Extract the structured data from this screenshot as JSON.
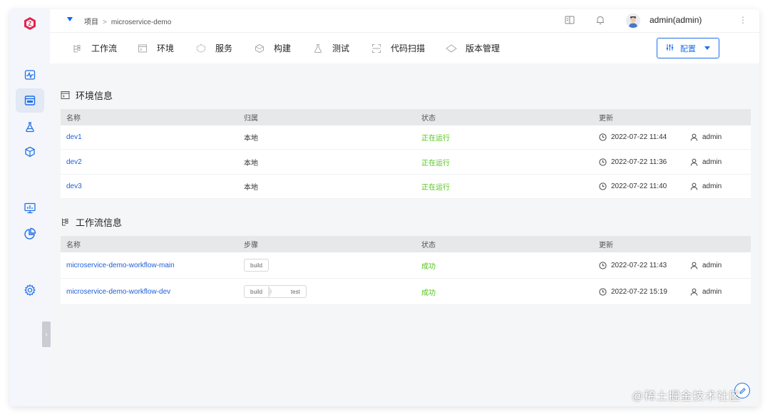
{
  "breadcrumb": {
    "root": "项目",
    "separator": ">",
    "project": "microservice-demo"
  },
  "user": {
    "name": "admin(admin)"
  },
  "tabs": [
    {
      "label": "工作流",
      "icon": "workflow-icon"
    },
    {
      "label": "环境",
      "icon": "environment-icon"
    },
    {
      "label": "服务",
      "icon": "service-icon"
    },
    {
      "label": "构建",
      "icon": "build-icon"
    },
    {
      "label": "测试",
      "icon": "test-icon"
    },
    {
      "label": "代码扫描",
      "icon": "scan-icon"
    },
    {
      "label": "版本管理",
      "icon": "version-icon"
    }
  ],
  "config_button": {
    "label": "配置"
  },
  "env_section": {
    "title": "环境信息",
    "headers": {
      "name": "名称",
      "owner": "归属",
      "status": "状态",
      "updated": "更新"
    },
    "rows": [
      {
        "name": "dev1",
        "owner": "本地",
        "status": "正在运行",
        "time": "2022-07-22 11:44",
        "user": "admin"
      },
      {
        "name": "dev2",
        "owner": "本地",
        "status": "正在运行",
        "time": "2022-07-22 11:36",
        "user": "admin"
      },
      {
        "name": "dev3",
        "owner": "本地",
        "status": "正在运行",
        "time": "2022-07-22 11:40",
        "user": "admin"
      }
    ]
  },
  "workflow_section": {
    "title": "工作流信息",
    "headers": {
      "name": "名称",
      "steps": "步骤",
      "status": "状态",
      "updated": "更新"
    },
    "rows": [
      {
        "name": "microservice-demo-workflow-main",
        "steps": [
          "build"
        ],
        "status": "成功",
        "time": "2022-07-22 11:43",
        "user": "admin"
      },
      {
        "name": "microservice-demo-workflow-dev",
        "steps": [
          "build",
          "test"
        ],
        "status": "成功",
        "time": "2022-07-22 15:19",
        "user": "admin"
      }
    ]
  },
  "watermark": "@稀土掘金技术社区",
  "colors": {
    "accent": "#1f6feb",
    "success": "#52c41a",
    "logo": "#e5254d"
  }
}
